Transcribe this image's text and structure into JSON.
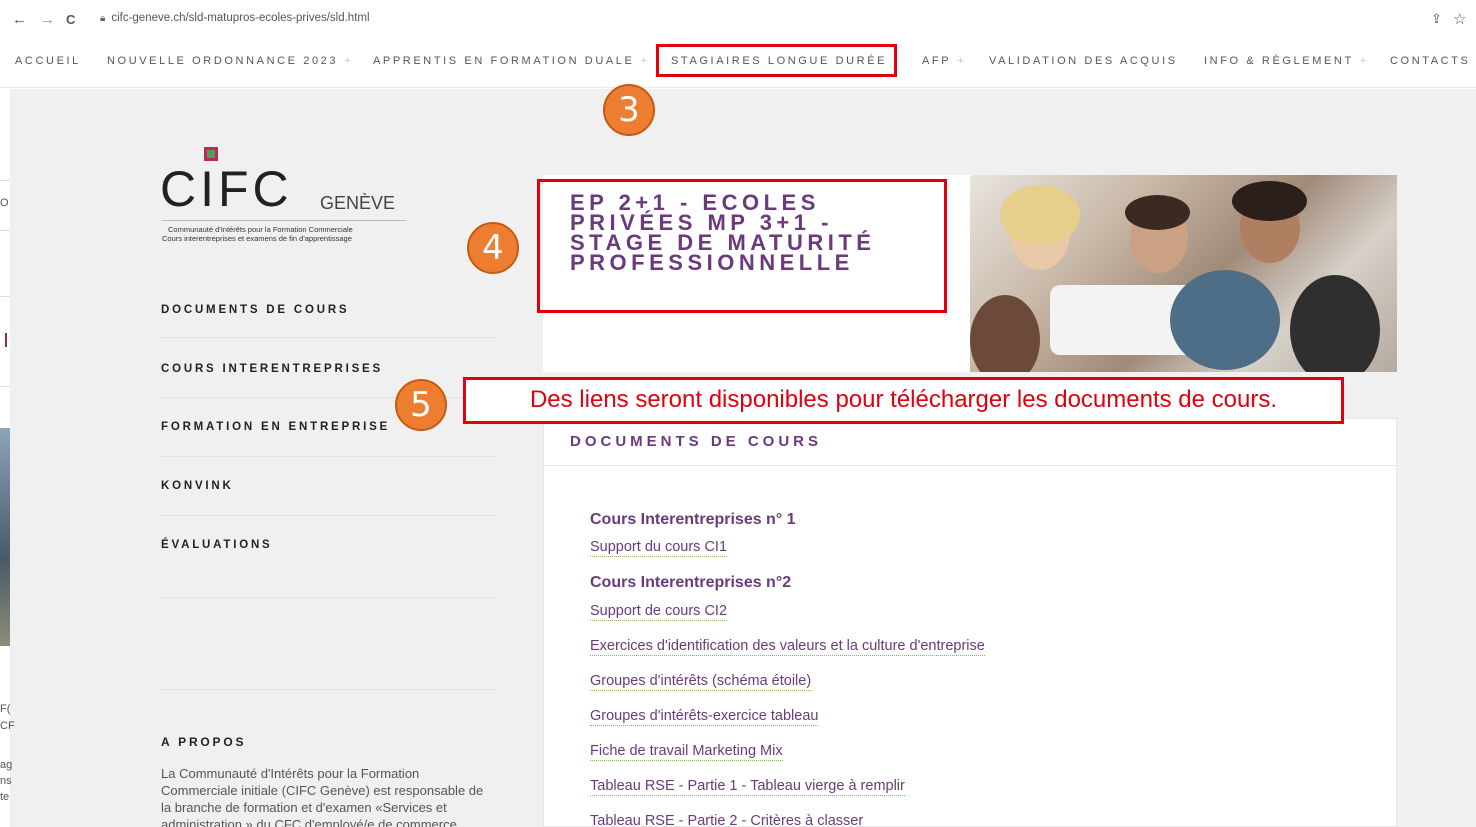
{
  "browser": {
    "url": "cifc-geneve.ch/sld-matupros-ecoles-prives/sld.html",
    "back_icon": "←",
    "forward_icon": "→",
    "reload_icon": "C",
    "share_icon": "⇪",
    "star_icon": "☆"
  },
  "topmenu": {
    "items": [
      {
        "label": "ACCUEIL",
        "plus": ""
      },
      {
        "label": "NOUVELLE ORDONNANCE 2023",
        "plus": "+"
      },
      {
        "label": "APPRENTIS EN FORMATION DUALE",
        "plus": "+"
      },
      {
        "label": "STAGIAIRES LONGUE DURÉE",
        "plus": ""
      },
      {
        "label": "AFP",
        "plus": "+"
      },
      {
        "label": "VALIDATION DES ACQUIS",
        "plus": ""
      },
      {
        "label": "INFO & RÈGLEMENT",
        "plus": "+"
      },
      {
        "label": "CONTACTS",
        "plus": ""
      }
    ]
  },
  "logo": {
    "name": "CIFC",
    "city": "GENÈVE",
    "subtitle_1": "Communauté d'Intérêts pour la Formation Commerciale",
    "subtitle_2": "Cours interentreprises et examens de fin d'apprentissage"
  },
  "sidebar": {
    "items": [
      {
        "label": "DOCUMENTS DE COURS"
      },
      {
        "label": "COURS INTERENTREPRISES"
      },
      {
        "label": "FORMATION EN ENTREPRISE"
      },
      {
        "label": "KONVINK"
      },
      {
        "label": "ÉVALUATIONS"
      }
    ],
    "about_title": "A PROPOS",
    "about_text": "La Communauté d'Intérêts pour la Formation Commerciale initiale (CIFC Genève) est responsable de la branche de formation et d'examen «Services et administration » du CFC d'employé/e de commerce"
  },
  "left_strip": {
    "text_1": "O",
    "text_2": "F(",
    "text_3": "CF",
    "text_4": "ag",
    "text_5": "ns",
    "text_6": "te"
  },
  "hero": {
    "title": "EP 2+1 - ECOLES PRIVÉES MP 3+1 - STAGE DE MATURITÉ PROFESSIONNELLE",
    "photo_label": "team-photo"
  },
  "content": {
    "title": "DOCUMENTS DE COURS",
    "section_1": "Cours Interentreprises n° 1",
    "section_1_link": "Support du cours CI1",
    "section_2": "Cours Interentreprises n°2",
    "links": [
      {
        "label": "Support de cours CI2"
      },
      {
        "label": "Exercices d'identification des valeurs et la culture d'entreprise"
      },
      {
        "label": "Groupes d'intérêts (schéma étoile)"
      },
      {
        "label": "Groupes d'intérêts-exercice tableau"
      },
      {
        "label": "Fiche de travail Marketing Mix"
      },
      {
        "label": "Tableau RSE - Partie 1 - Tableau vierge à remplir"
      },
      {
        "label": "Tableau RSE - Partie 2 - Critères à classer"
      }
    ]
  },
  "annotations": {
    "badge_3": "3",
    "badge_4": "4",
    "badge_5": "5",
    "callout": "Des liens seront disponibles pour télécharger les documents de cours.",
    "accent": "#e0000f",
    "badge_color": "#ed7d31"
  }
}
